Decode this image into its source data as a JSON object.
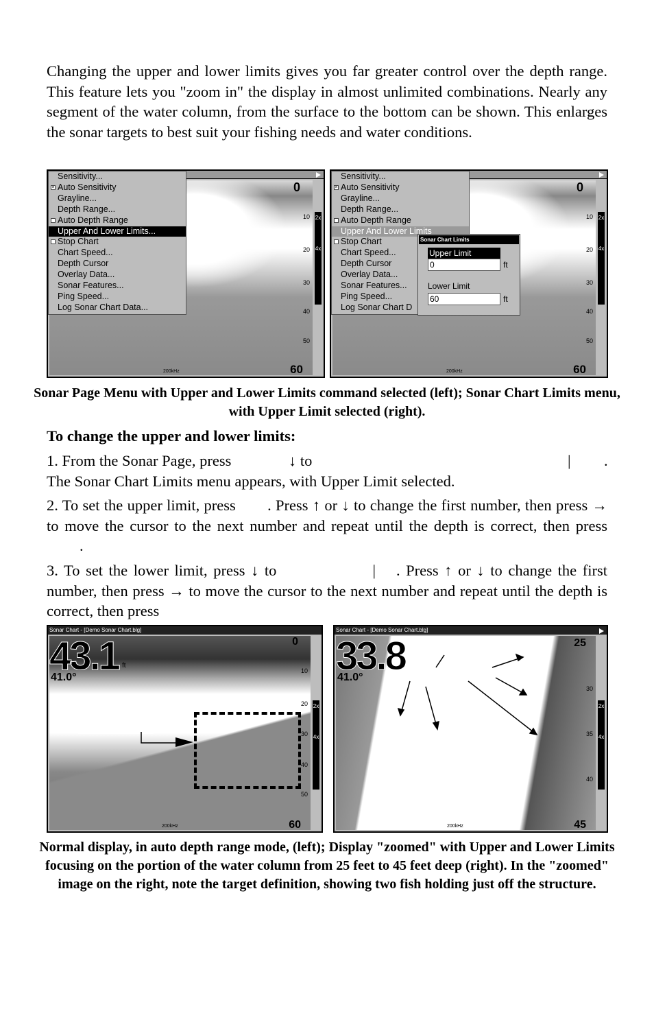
{
  "intro": "Changing the upper and lower limits gives you far greater control over the depth range. This feature lets you \"zoom in\" the display in almost unlimited combinations. Nearly any segment of the water column, from the surface to the bottom can be shown. This enlarges the sonar targets to best suit your fishing needs and water conditions.",
  "menu": {
    "items": [
      "Sensitivity...",
      "Auto Sensitivity",
      "Grayline...",
      "Depth Range...",
      "Auto Depth Range",
      "Upper And Lower Limits...",
      "Stop Chart",
      "Chart Speed...",
      "Depth Cursor",
      "Overlay Data...",
      "Sonar Features...",
      "Ping Speed...",
      "Log Sonar Chart Data..."
    ],
    "right_items": [
      "Sensitivity...",
      "Auto Sensitivity",
      "Grayline...",
      "Depth Range...",
      "Auto Depth Range",
      "Upper And Lower Limits",
      "Stop Chart",
      "Chart Speed...",
      "Depth Cursor",
      "Overlay Data...",
      "Sonar Features...",
      "Ping Speed...",
      "Log Sonar Chart D"
    ],
    "selected": "Upper And Lower Limits...",
    "auto_sensitivity_checked": true,
    "auto_depth_range_checked": false,
    "stop_chart_checked": false
  },
  "dialog": {
    "title": "Sonar Chart Limits",
    "upper_label": "Upper Limit",
    "upper_value": "0",
    "lower_label": "Lower Limit",
    "lower_value": "60",
    "unit": "ft"
  },
  "screens": {
    "top_scale": [
      "0",
      "10",
      "20",
      "30",
      "40",
      "50",
      "60"
    ],
    "freq": "200kHz",
    "zoom_labels": [
      "2x",
      "4x"
    ],
    "bottom_title": "Sonar Chart - [Demo Sonar Chart.blg]",
    "left_depth": "43.1",
    "left_depth_unit": "ft",
    "left_temp": "41.0°",
    "left_scale": [
      "0",
      "10",
      "20",
      "30",
      "40",
      "50",
      "60"
    ],
    "right_depth": "33.8",
    "right_temp": "41.0°",
    "right_scale": [
      "25",
      "30",
      "35",
      "40",
      "45"
    ]
  },
  "caption1": "Sonar Page Menu with Upper and Lower Limits command selected (left); Sonar Chart Limits menu, with Upper Limit selected (right).",
  "heading": "To change the upper and lower limits:",
  "steps": {
    "s1a": "1. From the Sonar Page, press ",
    "s1b": "↓ to",
    "s1c": "|",
    "s1d": ".",
    "s1e": "The Sonar Chart Limits menu appears, with Upper Limit selected.",
    "s2a": "2. To set the upper limit, press ",
    "s2b": ". Press ↑ or ↓ to change the first number, then press → to move the cursor to the next number and repeat until the depth is correct, then press ",
    "s2c": ".",
    "s3a": "3. To set the lower limit, press ↓ to",
    "s3b": "|",
    "s3c": ". Press ↑ or ↓ to change the first number, then press → to move the cursor to the next number and repeat until the depth is correct, then press"
  },
  "caption2": "Normal display, in auto depth range mode, (left); Display \"zoomed\" with Upper and Lower Limits focusing on the portion of the water column from 25 feet to 45 feet deep (right). In the \"zoomed\" image on the right, note the target definition, showing two fish holding just off the structure."
}
